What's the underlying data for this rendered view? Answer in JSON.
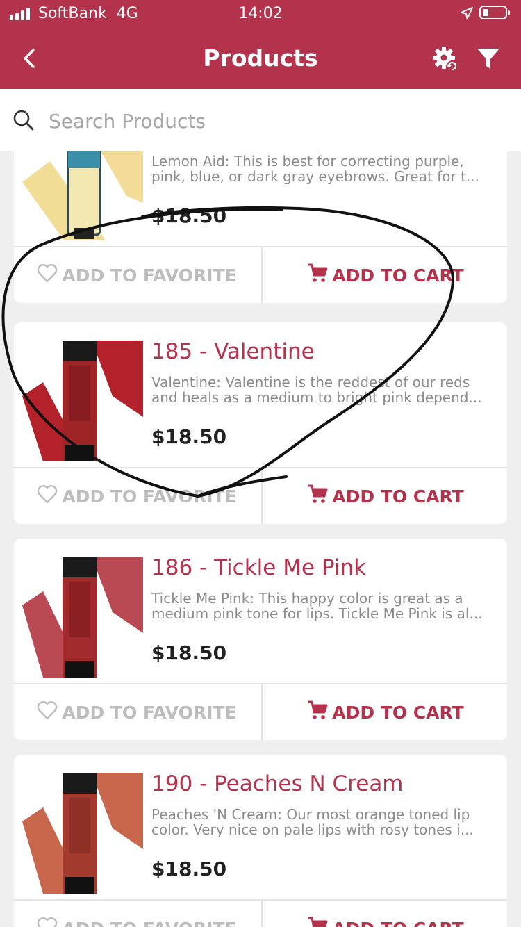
{
  "status_bar": {
    "carrier": "SoftBank",
    "network": "4G",
    "time": "14:02"
  },
  "nav": {
    "title": "Products"
  },
  "search": {
    "placeholder": "Search Products",
    "value": ""
  },
  "products": [
    {
      "name": "",
      "description": "Lemon Aid: This is best for correcting purple, pink, blue, or dark gray eyebrows. Great for t...",
      "price": "$18.50",
      "favorite_label": "ADD TO FAVORITE",
      "cart_label": "ADD TO CART",
      "swatch_color": "#f1d98c",
      "tube_color": "#3b8fa8"
    },
    {
      "name": "185 - Valentine",
      "description": "Valentine: Valentine is the reddest of our reds and heals as a medium to bright pink depend...",
      "price": "$18.50",
      "favorite_label": "ADD TO FAVORITE",
      "cart_label": "ADD TO CART",
      "swatch_color": "#b3212a",
      "tube_color": "#9e2426"
    },
    {
      "name": "186 - Tickle Me Pink",
      "description": "Tickle Me Pink: This happy color is great as a medium pink tone for lips. Tickle Me Pink is al...",
      "price": "$18.50",
      "favorite_label": "ADD TO FAVORITE",
      "cart_label": "ADD TO CART",
      "swatch_color": "#b94a54",
      "tube_color": "#a12a2c"
    },
    {
      "name": "190 - Peaches N Cream",
      "description": "Peaches 'N Cream: Our most orange toned lip color. Very nice on pale lips with rosy tones i...",
      "price": "$18.50",
      "favorite_label": "ADD TO FAVORITE",
      "cart_label": "ADD TO CART",
      "swatch_color": "#c8674c",
      "tube_color": "#a33a2e"
    }
  ],
  "theme": {
    "accent": "#b3334c",
    "background": "#efefef"
  }
}
